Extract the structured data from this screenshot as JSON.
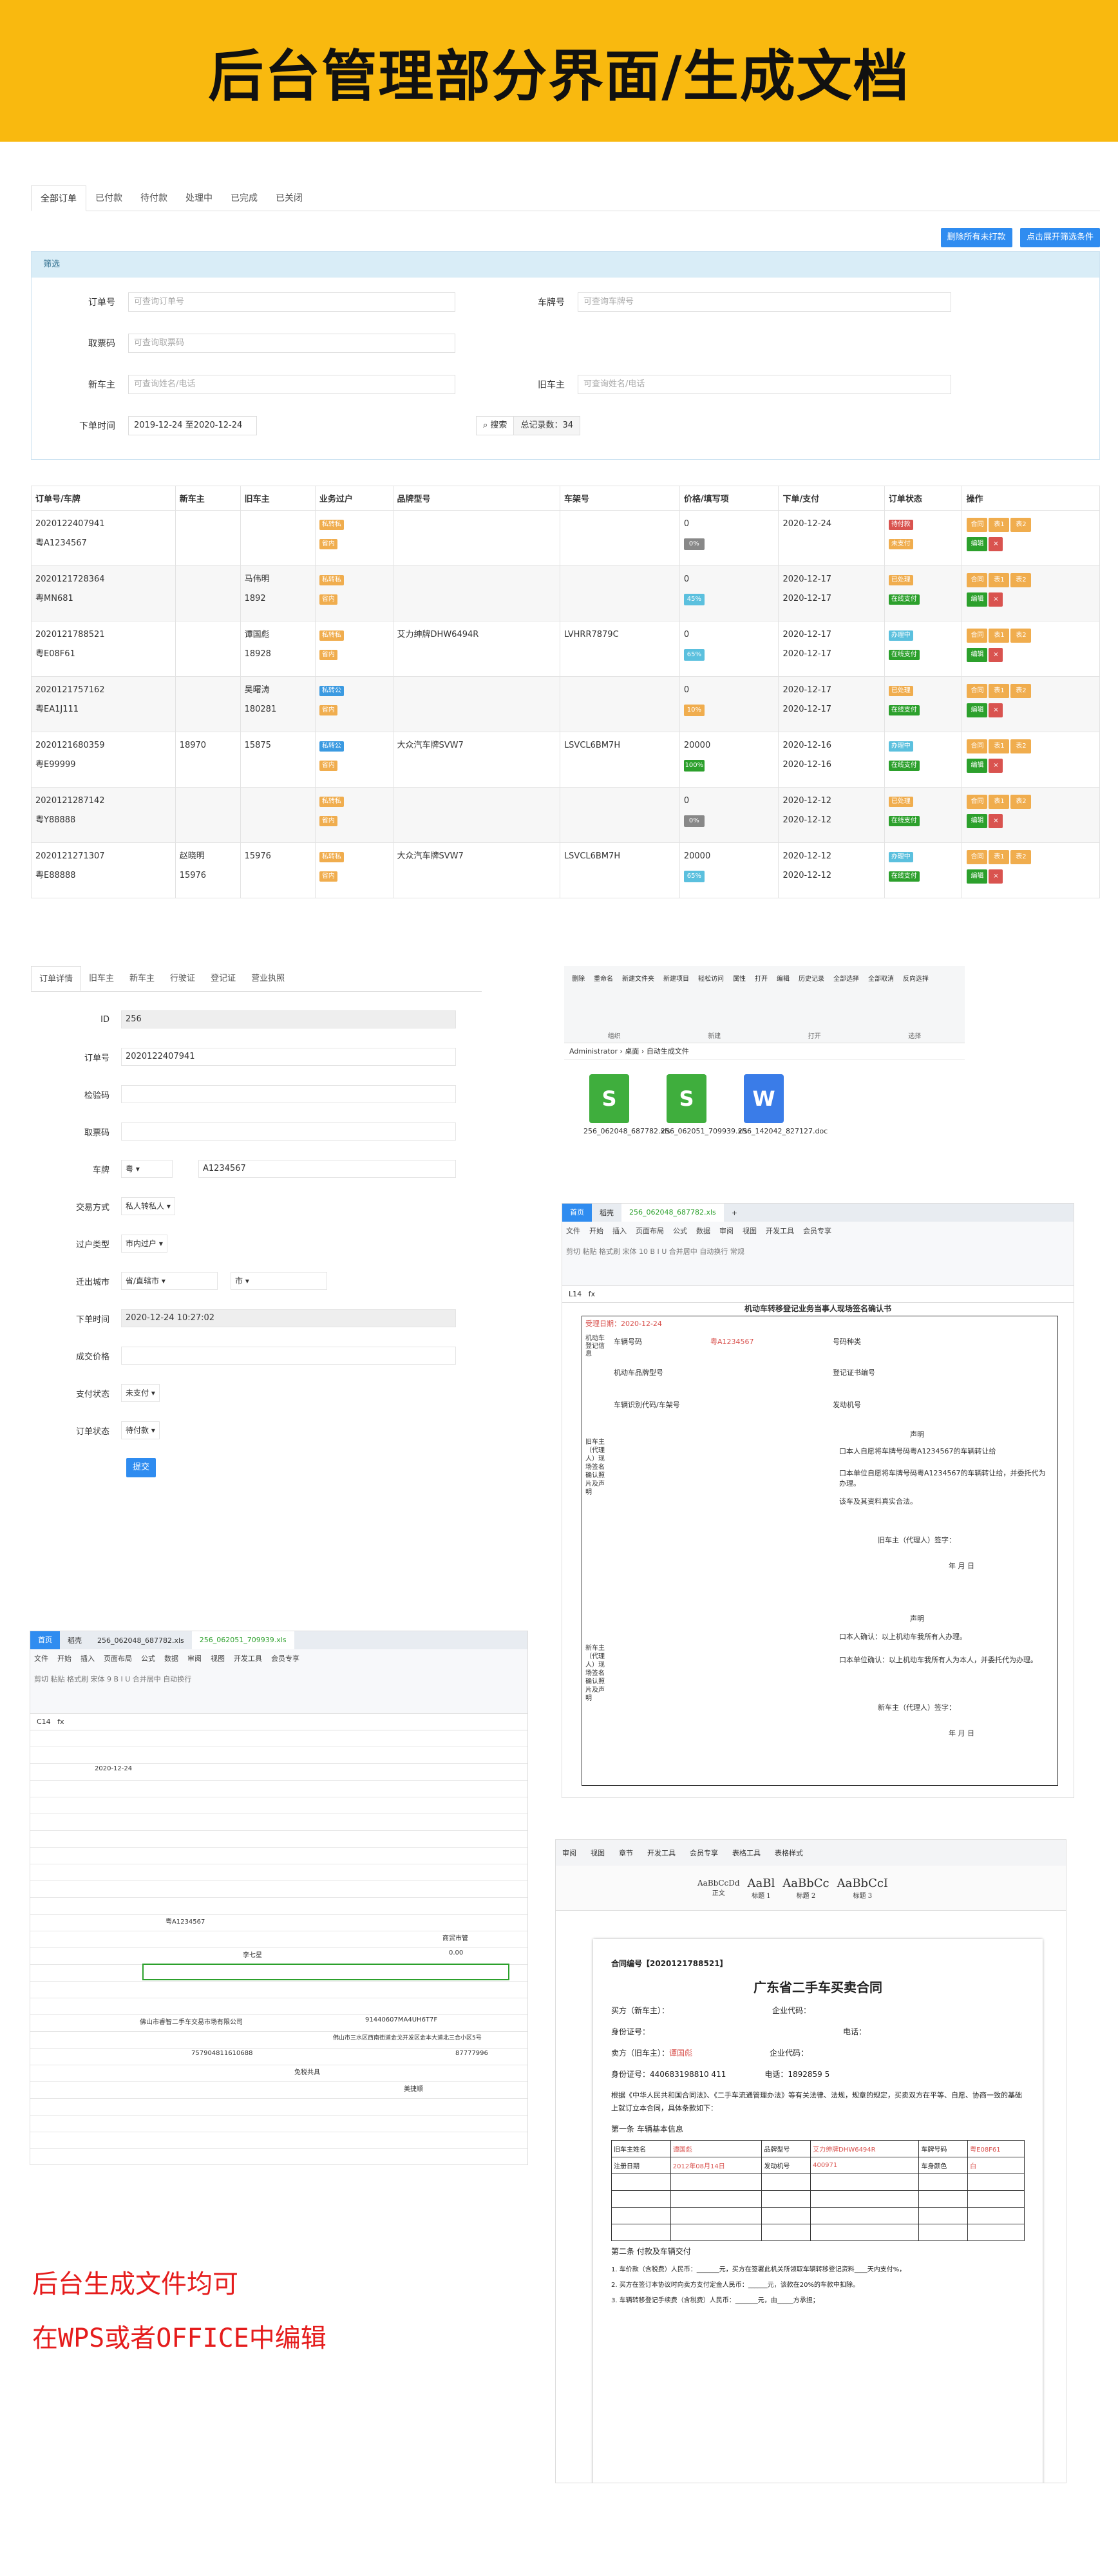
{
  "banner": {
    "title": "后台管理部分界面/生成文档"
  },
  "orders": {
    "tabs": [
      "全部订单",
      "已付款",
      "待付款",
      "处理中",
      "已完成",
      "已关闭"
    ],
    "btn_delete": "删除所有未打款",
    "btn_expand": "点击展开筛选条件",
    "filter_title": "筛选",
    "f_order_label": "订单号",
    "f_order_ph": "可查询订单号",
    "f_car_label": "车牌号",
    "f_car_ph": "可查询车牌号",
    "f_buyer_label": "取票码",
    "f_buyer_ph": "可查询取票码",
    "f_new_label": "新车主",
    "f_new_ph": "可查询姓名/电话",
    "f_old_label": "旧车主",
    "f_old_ph": "可查询姓名/电话",
    "f_time_label": "下单时间",
    "f_time_value": "2019-12-24 至2020-12-24",
    "search_btn": "搜索",
    "total_label": "总记录数：34",
    "columns": [
      "订单号/车牌",
      "新车主",
      "旧车主",
      "业务过户",
      "品牌型号",
      "车架号",
      "价格/填写项",
      "下单/支付",
      "订单状态",
      "操作"
    ],
    "rows": [
      {
        "order": "2020122407941",
        "plate": "粤A1234567",
        "new": "",
        "newph": "",
        "old": "",
        "oldph": "",
        "tags": [
          "私转私",
          "省内"
        ],
        "brand": "",
        "vin": "",
        "price": "0",
        "pct": "0%",
        "d1": "2020-12-24",
        "d2": "",
        "st1": "待付款",
        "st2": "未支付"
      },
      {
        "order": "2020121728364",
        "plate": "粤MN681",
        "new": "",
        "newph": "",
        "old": "马伟明",
        "oldph": "1892",
        "tags": [
          "私转私",
          "省内"
        ],
        "brand": "",
        "vin": "",
        "price": "0",
        "pct": "45%",
        "d1": "2020-12-17",
        "d2": "2020-12-17",
        "st1": "已处理",
        "st2": "在线支付"
      },
      {
        "order": "2020121788521",
        "plate": "粤E08F61",
        "new": "",
        "newph": "",
        "old": "谭国彪",
        "oldph": "18928",
        "tags": [
          "私转私",
          "省内"
        ],
        "brand": "艾力绅牌DHW6494R",
        "vin": "LVHRR7879C",
        "price": "0",
        "pct": "65%",
        "d1": "2020-12-17",
        "d2": "2020-12-17",
        "st1": "办理中",
        "st2": "在线支付"
      },
      {
        "order": "2020121757162",
        "plate": "粤EA1J111",
        "new": "",
        "newph": "",
        "old": "吴曙涛",
        "oldph": "180281",
        "tags": [
          "私转公",
          "省内"
        ],
        "brand": "",
        "vin": "",
        "price": "0",
        "pct": "10%",
        "d1": "2020-12-17",
        "d2": "2020-12-17",
        "st1": "已处理",
        "st2": "在线支付"
      },
      {
        "order": "2020121680359",
        "plate": "粤E99999",
        "new": "",
        "newph": "18970",
        "old": "",
        "oldph": "15875",
        "tags": [
          "私转公",
          "省内"
        ],
        "brand": "大众汽车牌SVW7",
        "vin": "LSVCL6BM7H",
        "price": "20000",
        "pct": "100%",
        "d1": "2020-12-16",
        "d2": "2020-12-16",
        "st1": "办理中",
        "st2": "在线支付"
      },
      {
        "order": "2020121287142",
        "plate": "粤Y88888",
        "new": "",
        "newph": "",
        "old": "",
        "oldph": "",
        "tags": [
          "私转私",
          "省内"
        ],
        "brand": "",
        "vin": "",
        "price": "0",
        "pct": "0%",
        "d1": "2020-12-12",
        "d2": "2020-12-12",
        "st1": "已处理",
        "st2": "在线支付"
      },
      {
        "order": "2020121271307",
        "plate": "粤E88888",
        "new": "赵晓明",
        "newph": "15976",
        "old": "",
        "oldph": "15976",
        "tags": [
          "私转私",
          "省内"
        ],
        "brand": "大众汽车牌SVW7",
        "vin": "LSVCL6BM7H",
        "price": "20000",
        "pct": "65%",
        "d1": "2020-12-12",
        "d2": "2020-12-12",
        "st1": "办理中",
        "st2": "在线支付"
      }
    ],
    "ops": [
      "合同",
      "表1",
      "表2",
      "编辑",
      "×"
    ]
  },
  "detail": {
    "tabs": [
      "订单详情",
      "旧车主",
      "新车主",
      "行驶证",
      "登记证",
      "营业执照"
    ],
    "id_label": "ID",
    "id_value": "256",
    "order_label": "订单号",
    "order_value": "2020122407941",
    "check_label": "检验码",
    "pick_label": "取票码",
    "plate_label": "车牌",
    "plate_prefix": "粤",
    "plate_value": "A1234567",
    "trade_label": "交易方式",
    "trade_value": "私人转私人",
    "type_label": "过户类型",
    "type_value": "市内过户",
    "city_label": "迁出城市",
    "city_value": "省/直辖市",
    "city2": "市",
    "time_label": "下单时间",
    "time_value": "2020-12-24 10:27:02",
    "deal_label": "成交价格",
    "pay_label": "支付状态",
    "pay_value": "未支付",
    "status_label": "订单状态",
    "status_value": "待付款",
    "submit": "提交"
  },
  "explorer": {
    "path": [
      "Administrator",
      "桌面",
      "自动生成文件"
    ],
    "tools": [
      "删除",
      "重命名",
      "新建文件夹",
      "新建项目",
      "轻松访问",
      "属性",
      "打开",
      "编辑",
      "历史记录",
      "全部选择",
      "全部取消",
      "反向选择"
    ],
    "groups": [
      "组织",
      "新建",
      "打开",
      "选择"
    ],
    "files": [
      {
        "icon": "S",
        "color": "#3fae3d",
        "name": "256_062048_687782.xls"
      },
      {
        "icon": "S",
        "color": "#3fae3d",
        "name": "256_062051_709939.xls"
      },
      {
        "icon": "W",
        "color": "#3a7ce8",
        "name": "256_142042_827127.doc"
      }
    ]
  },
  "sheet1": {
    "tabs": [
      "首页",
      "稻壳",
      "256_062048_687782.xls"
    ],
    "menus": [
      "文件",
      "开始",
      "插入",
      "页面布局",
      "公式",
      "数据",
      "审阅",
      "视图",
      "开发工具",
      "会员专享"
    ],
    "cellref": "L14",
    "title": "机动车转移登记业务当事人现场签名确认书",
    "date": "受理日期：2020-12-24",
    "plate_label": "车辆号码",
    "plate": "粤A1234567",
    "type_label": "号码种类",
    "brand_label": "机动车品牌型号",
    "reg_label": "登记证书编号",
    "vin_label": "车辆识别代码/车架号",
    "engine_label": "发动机号",
    "side1": "机动车登记信息",
    "old_side": "旧车主（代理人）现场签名确认照片及声明",
    "new_side": "新车主（代理人）现场签名确认照片及声明",
    "decl": "声明",
    "o1": "口本人自愿将车牌号码粤A1234567的车辆转让给",
    "o2": "口本单位自愿将车牌号码粤A1234567的车辆转让给，并委托代为办理。",
    "o3": "该车及其资料真实合法。",
    "sign_old": "旧车主（代理人）签字：",
    "sign_new": "新车主（代理人）签字：",
    "ymd": "年      月      日",
    "n1": "口本人确认：以上机动车我所有人办理。",
    "n2": "口本单位确认：以上机动车我所有人为本人，并委托代为办理。"
  },
  "sheet2": {
    "tabs": [
      "首页",
      "稻壳",
      "256_062048_687782.xls",
      "256_062051_709939.xls"
    ],
    "cellref": "C14",
    "date": "2020-12-24",
    "plate": "粤A1234567",
    "market": "商贸市管",
    "car": "李七星",
    "amount": "0.00",
    "company": "佛山市睿智二手车交易市场有限公司",
    "code": "91440607MA4UH6T7F",
    "addr": "佛山市三水区西南街道金戈开发区金本大道北三合小区5号",
    "phone": "757904811610688",
    "tel": "87777996",
    "free": "免税共具",
    "rep": "美捷顺"
  },
  "note": {
    "l1": "后台生成文件均可",
    "l2": "在WPS或者OFFICE中编辑"
  },
  "doc": {
    "menus": [
      "审阅",
      "视图",
      "章节",
      "开发工具",
      "会员专享",
      "表格工具",
      "表格样式"
    ],
    "styles": [
      "AaBbCcDd",
      "AaBl",
      "AaBbCc",
      "AaBbCcI"
    ],
    "style_labels": [
      "正文",
      "标题 1",
      "标题 2",
      "标题 3"
    ],
    "contract_no": "合同编号【2020121788521】",
    "title": "广东省二手车买卖合同",
    "a_label": "买方（新车主）：",
    "a_corp": "企业代码：",
    "a_id": "身份证号：",
    "a_tel": "电话：",
    "b_label": "卖方（旧车主）：",
    "b_name": "谭国彪",
    "b_corp": "企业代码：",
    "b_id": "身份证号：440683198810   411",
    "b_tel": "电话：1892859   5",
    "intro": "根据《中华人民共和国合同法》、《二手车流通管理办法》等有关法律、法规，规章的规定，买卖双方在平等、自愿、协商一致的基础上就订立本合同，具体条款如下：",
    "sec1": "第一条  车辆基本信息",
    "seller": "旧车主姓名",
    "seller_v": "谭国彪",
    "brand": "品牌型号",
    "brand_v": "艾力绅牌DHW6494R",
    "plate_k": "车牌号码",
    "plate_v": "粤E08F61",
    "reg_date": "注册日期",
    "reg_v": "2012年08月14日",
    "engine": "发动机号",
    "engine_v": "400971",
    "color": "车身颜色",
    "color_v": "白",
    "sec2": "第二条  付款及车辆交付",
    "l1": "1. 车价款（含税费）人民币：_______元，买方在签署此机关所领取车辆转移登记资料____天内支付%，",
    "l2": "2. 买方在签订本协议时向卖方支付定金人民币：______元，该款在20%的车款中扣除。",
    "l3": "3. 车辆转移登记手续费（含税费）人民币：_______元，由_____方承担；"
  }
}
